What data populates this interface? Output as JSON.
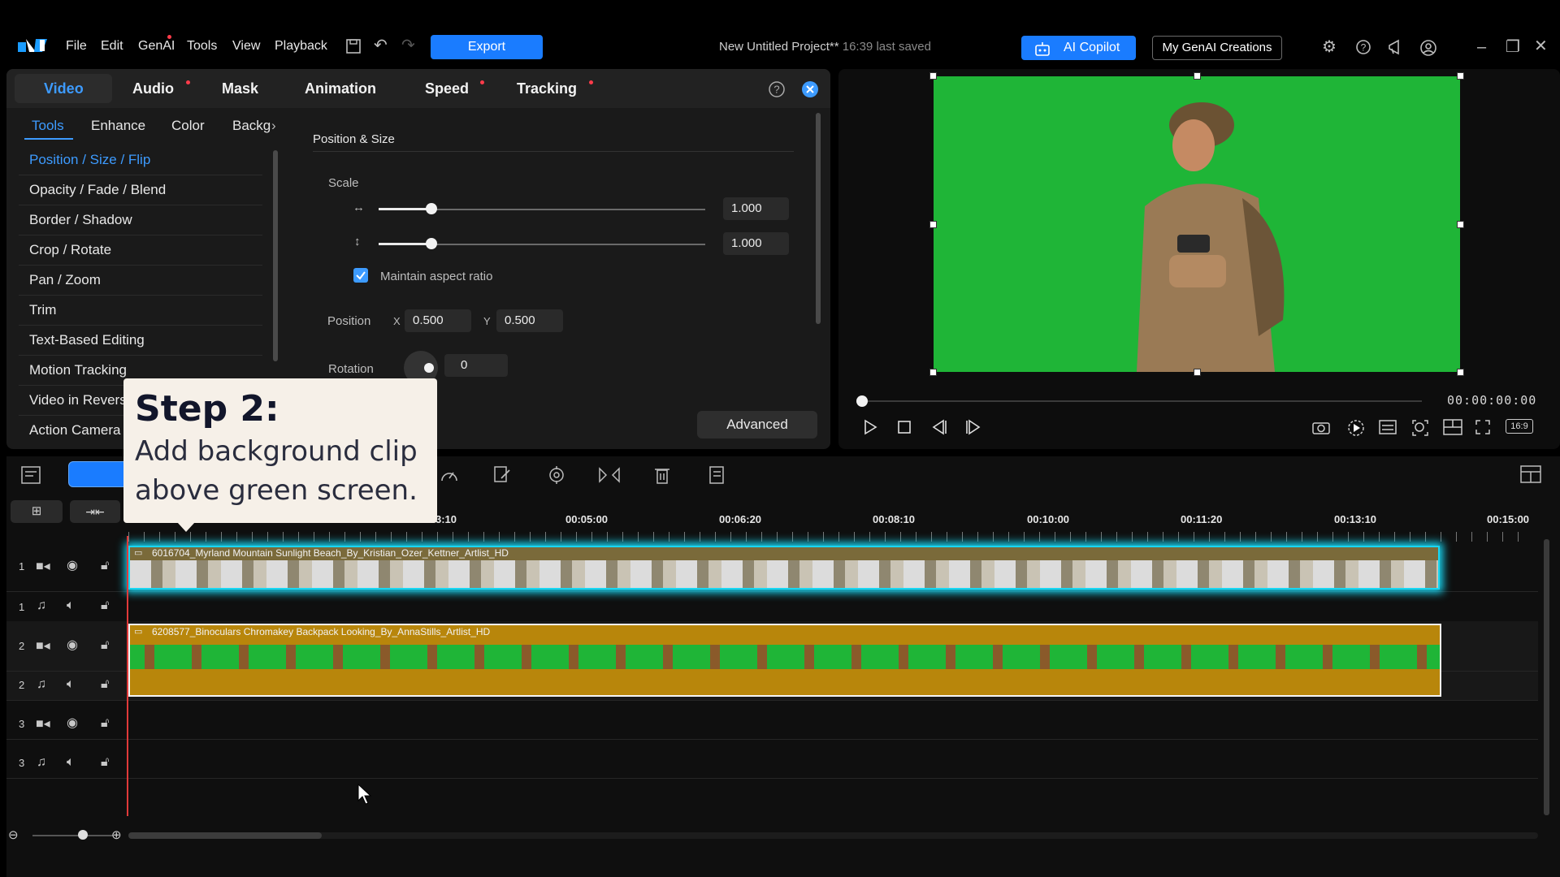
{
  "menubar": {
    "items": [
      "File",
      "Edit",
      "GenAI",
      "Tools",
      "View",
      "Playback"
    ],
    "export_label": "Export",
    "project_title": "New Untitled Project**",
    "project_saved": "16:39 last saved",
    "copilot_label": "AI Copilot",
    "genai_creations_label": "My GenAI Creations"
  },
  "panel": {
    "top_tabs": [
      "Video",
      "Audio",
      "Mask",
      "Animation",
      "Speed",
      "Tracking"
    ],
    "sub_tabs": [
      "Tools",
      "Enhance",
      "Color",
      "Backg"
    ],
    "tools": [
      "Position / Size / Flip",
      "Opacity / Fade / Blend",
      "Border / Shadow",
      "Crop / Rotate",
      "Pan / Zoom",
      "Trim",
      "Text-Based Editing",
      "Motion Tracking",
      "Video in Revers",
      "Action Camera"
    ],
    "section_title": "Position & Size",
    "scale_label": "Scale",
    "scale_w": "1.000",
    "scale_h": "1.000",
    "maintain_label": "Maintain aspect ratio",
    "position_label": "Position",
    "x_label": "X",
    "x_value": "0.500",
    "y_label": "Y",
    "y_value": "0.500",
    "rotation_label": "Rotation",
    "rotation_value": "0",
    "advanced_label": "Advanced"
  },
  "preview": {
    "timecode": "00:00:00:00",
    "aspect_label": "16:9"
  },
  "callout": {
    "title": "Step 2:",
    "line1": "Add background clip",
    "line2": "above green screen."
  },
  "timeline": {
    "ruler": [
      "3:10",
      "00:05:00",
      "00:06:20",
      "00:08:10",
      "00:10:00",
      "00:11:20",
      "00:13:10",
      "00:15:00"
    ],
    "tracks": [
      "1",
      "1",
      "2",
      "2",
      "3",
      "3"
    ],
    "clip1_title": "6016704_Myrland Mountain Sunlight Beach_By_Kristian_Ozer_Kettner_Artlist_HD",
    "clip2_title": "6208577_Binoculars Chromakey Backpack Looking_By_AnnaStills_Artlist_HD"
  },
  "colors": {
    "accent": "#1a7cff",
    "green_screen": "#1fb537",
    "clip_selected_glow": "#19d6f2",
    "clip_gold": "#b8860b"
  }
}
